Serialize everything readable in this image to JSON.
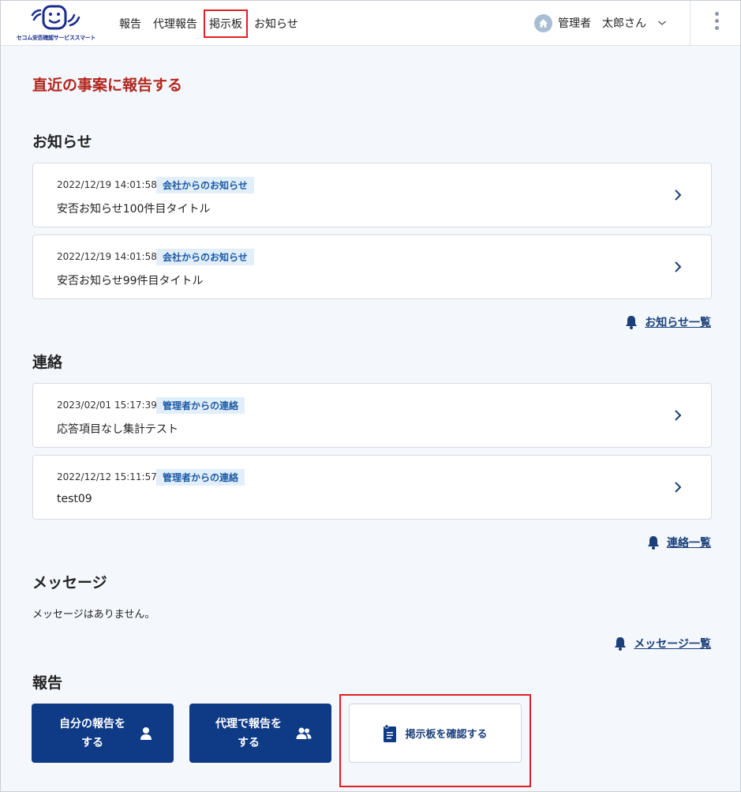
{
  "header": {
    "logo_text": "セコム安否確認サービススマート",
    "nav": [
      "報告",
      "代理報告",
      "掲示板",
      "お知らせ"
    ],
    "user_role": "管理者",
    "user_name": "太郎さん"
  },
  "page_title": "直近の事案に報告する",
  "notices": {
    "title": "お知らせ",
    "items": [
      {
        "date": "2022/12/19 14:01:58",
        "badge": "会社からのお知らせ",
        "title": "安否お知らせ100件目タイトル"
      },
      {
        "date": "2022/12/19 14:01:58",
        "badge": "会社からのお知らせ",
        "title": "安否お知らせ99件目タイトル"
      }
    ],
    "list_link": "お知らせ一覧"
  },
  "contacts": {
    "title": "連絡",
    "items": [
      {
        "date": "2023/02/01 15:17:39",
        "badge": "管理者からの連絡",
        "title": "応答項目なし集計テスト"
      },
      {
        "date": "2022/12/12 15:11:57",
        "badge": "管理者からの連絡",
        "title": "test09"
      }
    ],
    "list_link": "連絡一覧"
  },
  "messages": {
    "title": "メッセージ",
    "empty": "メッセージはありません。",
    "list_link": "メッセージ一覧"
  },
  "report": {
    "title": "報告",
    "self_line1": "自分の報告を",
    "self_line2": "する",
    "proxy_line1": "代理で報告を",
    "proxy_line2": "する",
    "board": "掲示板を確認する"
  },
  "colors": {
    "accent_red": "#b3261e",
    "primary_blue": "#0f3a86",
    "badge_bg": "#e2eef9",
    "highlight": "#e02020"
  },
  "icons": [
    "home-icon",
    "chevron-down-icon",
    "kebab-menu-icon",
    "chevron-right-icon",
    "bell-icon",
    "person-icon",
    "people-icon",
    "document-icon"
  ]
}
